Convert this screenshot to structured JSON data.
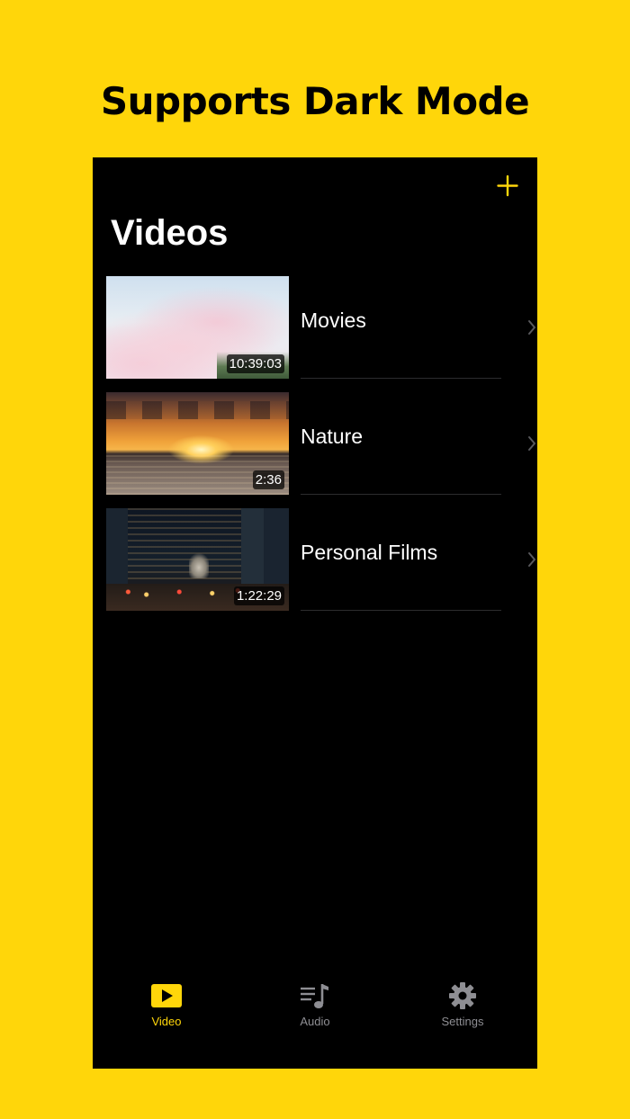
{
  "headline": "Supports Dark Mode",
  "nav": {
    "add_icon": "plus-icon"
  },
  "page_title": "Videos",
  "rows": [
    {
      "label": "Movies",
      "duration": "10:39:03",
      "thumbnail": "pink-clouds-sky"
    },
    {
      "label": "Nature",
      "duration": "2:36",
      "thumbnail": "sunset-over-sea"
    },
    {
      "label": "Personal Films",
      "duration": "1:22:29",
      "thumbnail": "city-street-night"
    }
  ],
  "tabs": [
    {
      "label": "Video",
      "icon": "play-icon",
      "active": true
    },
    {
      "label": "Audio",
      "icon": "music-list-icon",
      "active": false
    },
    {
      "label": "Settings",
      "icon": "gear-icon",
      "active": false
    }
  ],
  "colors": {
    "background": "#FFD60A",
    "accent": "#FFD60A",
    "screen": "#000000",
    "inactive_tab": "#8E8E93",
    "separator": "#2C2C2E",
    "chevron": "#5A5A5E"
  }
}
